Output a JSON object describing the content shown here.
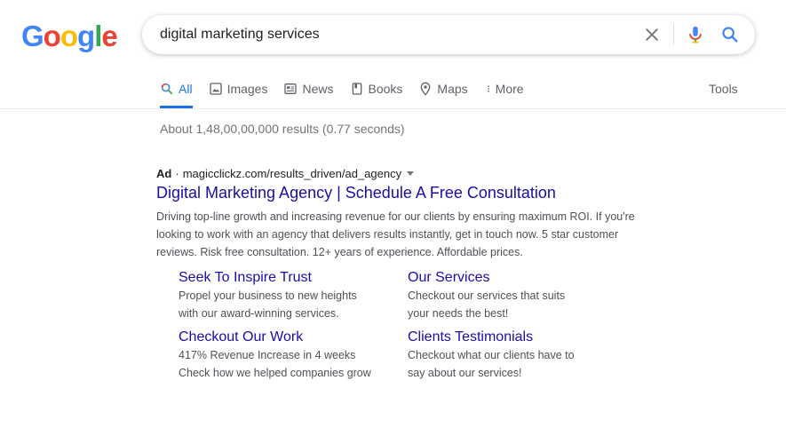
{
  "header": {
    "logo": [
      "G",
      "o",
      "o",
      "g",
      "l",
      "e"
    ],
    "logo_colors": [
      "#4285F4",
      "#EA4335",
      "#FBBC05",
      "#4285F4",
      "#34A853",
      "#EA4335"
    ],
    "search_value": "digital marketing services"
  },
  "tabs": [
    {
      "label": "All",
      "icon": "search-icon",
      "active": true
    },
    {
      "label": "Images",
      "icon": "image-icon"
    },
    {
      "label": "News",
      "icon": "news-icon"
    },
    {
      "label": "Books",
      "icon": "book-icon"
    },
    {
      "label": "Maps",
      "icon": "map-pin-icon"
    },
    {
      "label": "More",
      "icon": "more-vert-icon"
    }
  ],
  "tools_label": "Tools",
  "stats": "About 1,48,00,00,000 results (0.77 seconds)",
  "ad": {
    "label": "Ad",
    "separator": "·",
    "url": "magicclickz.com/results_driven/ad_agency",
    "title": "Digital Marketing Agency | Schedule A Free Consultation",
    "description": "Driving top-line growth and increasing revenue for our clients by ensuring maximum ROI. If you're looking to work with an agency that delivers results instantly, get in touch now. 5 star customer reviews. Risk free consultation. 12+ years of experience. Affordable prices."
  },
  "sitelinks": [
    {
      "title": "Seek To Inspire Trust",
      "lines": [
        "Propel your business to new heights",
        "with our award-winning services."
      ]
    },
    {
      "title": "Our Services",
      "lines": [
        "Checkout our services that suits",
        "your needs the best!"
      ]
    },
    {
      "title": "Checkout Our Work",
      "lines": [
        "417% Revenue Increase in 4 weeks",
        "Check how we helped companies grow"
      ]
    },
    {
      "title": "Clients Testimonials",
      "lines": [
        "Checkout what our clients have to",
        "say about our services!"
      ]
    }
  ],
  "colors": {
    "link": "#1a0dab",
    "accent": "#1a73e8",
    "muted": "#70757a"
  }
}
